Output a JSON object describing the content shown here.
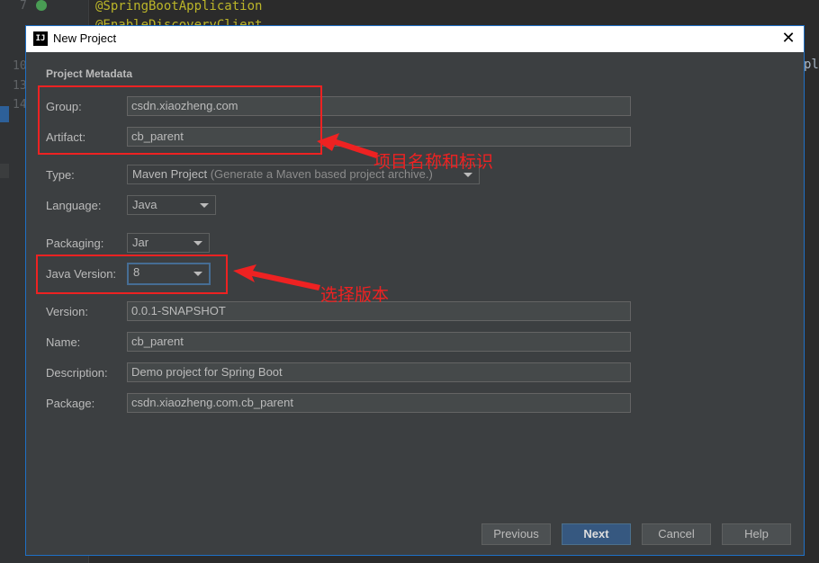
{
  "editor": {
    "line_numbers": [
      "7",
      "10",
      "13",
      "14"
    ],
    "code_lines": [
      "@SpringBootApplication",
      "@EnableDiscoveryClient"
    ],
    "right_edge_text": "pl"
  },
  "dialog": {
    "title": "New Project",
    "app_icon_text": "IJ",
    "close_glyph": "✕",
    "section_title": "Project Metadata",
    "fields": {
      "group": {
        "label": "Group:",
        "value": "csdn.xiaozheng.com"
      },
      "artifact": {
        "label": "Artifact:",
        "value": "cb_parent"
      },
      "type": {
        "label": "Type:",
        "value": "Maven Project",
        "hint": "(Generate a Maven based project archive.)"
      },
      "language": {
        "label": "Language:",
        "value": "Java"
      },
      "packaging": {
        "label": "Packaging:",
        "value": "Jar"
      },
      "java_version": {
        "label": "Java Version:",
        "value": "8"
      },
      "version": {
        "label": "Version:",
        "value": "0.0.1-SNAPSHOT"
      },
      "name": {
        "label": "Name:",
        "value": "cb_parent"
      },
      "description": {
        "label": "Description:",
        "value": "Demo project for Spring Boot"
      },
      "package": {
        "label": "Package:",
        "value": "csdn.xiaozheng.com.cb_parent"
      }
    },
    "buttons": {
      "previous": "Previous",
      "next": "Next",
      "cancel": "Cancel",
      "help": "Help"
    }
  },
  "annotations": {
    "project_name_note": "项目名称和标识",
    "version_note": "选择版本",
    "color": "#ee2222"
  },
  "colors": {
    "dialog_bg": "#3c3f41",
    "accent": "#1f70c6",
    "primary_button": "#365880"
  }
}
